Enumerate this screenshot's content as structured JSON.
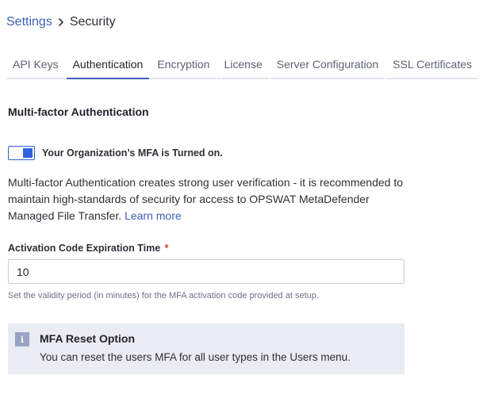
{
  "breadcrumb": {
    "parent": "Settings",
    "separator_icon": "chevron-right-icon",
    "current": "Security"
  },
  "tabs": [
    {
      "label": "API Keys",
      "active": false
    },
    {
      "label": "Authentication",
      "active": true
    },
    {
      "label": "Encryption",
      "active": false
    },
    {
      "label": "License",
      "active": false
    },
    {
      "label": "Server Configuration",
      "active": false
    },
    {
      "label": "SSL Certificates",
      "active": false
    }
  ],
  "mfa": {
    "section_title": "Multi-factor Authentication",
    "toggle_on": true,
    "toggle_label": "Your Organization’s MFA is Turned on.",
    "description": "Multi-factor Authentication creates strong user verification - it is recommended to maintain high-standards of security for access to OPSWAT MetaDefender Managed File Transfer.",
    "learn_more": "Learn more"
  },
  "activation_field": {
    "label": "Activation Code Expiration Time",
    "required_marker": "*",
    "value": "10",
    "help": "Set the validity period (in minutes) for the MFA activation code provided at setup."
  },
  "reset_info": {
    "icon": "info-icon",
    "icon_glyph": "i",
    "title": "MFA Reset Option",
    "text": "You can reset the users MFA for all user types in the Users menu."
  },
  "colors": {
    "accent": "#3d5fb7",
    "toggle": "#2f62e0",
    "required": "#d93636",
    "info_bg": "#e9ecf2"
  }
}
